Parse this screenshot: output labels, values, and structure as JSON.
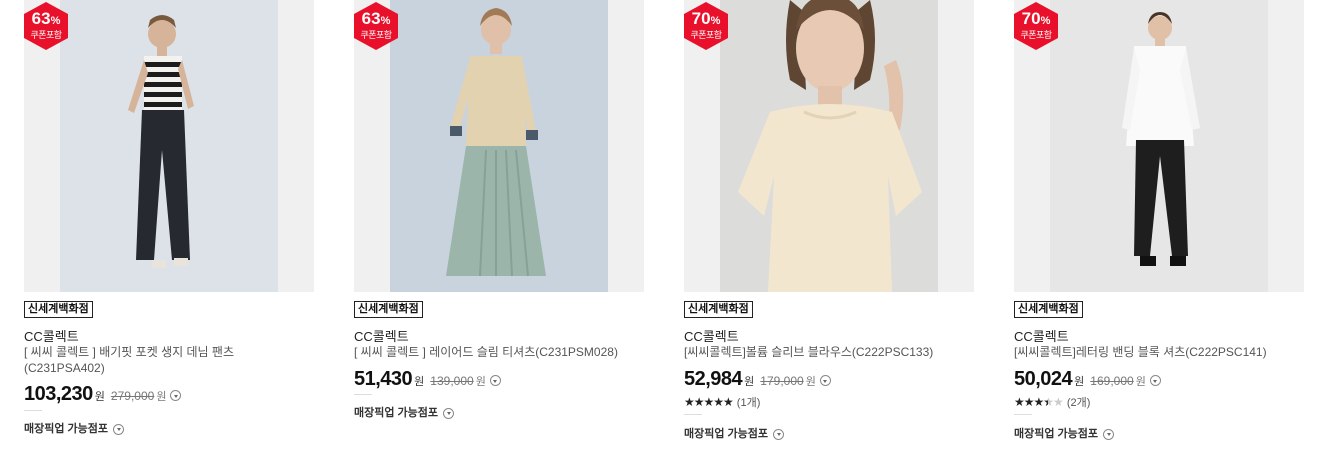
{
  "colors": {
    "badge": "#e8102a",
    "text": "#222222",
    "muted": "#777777"
  },
  "products": [
    {
      "badge": {
        "percent": "63",
        "unit": "%",
        "sub": "쿠폰포함"
      },
      "store": "신세계백화점",
      "brand": "CC콜렉트",
      "name": "[ 씨씨 콜렉트 ] 배기핏 포켓 생지 데님 팬츠(C231PSA402)",
      "price": "103,230",
      "won": "원",
      "original_price": "279,000",
      "original_won": "원",
      "pickup": "매장픽업 가능점포"
    },
    {
      "badge": {
        "percent": "63",
        "unit": "%",
        "sub": "쿠폰포함"
      },
      "store": "신세계백화점",
      "brand": "CC콜렉트",
      "name": "[ 씨씨 콜렉트 ] 레이어드 슬림 티셔츠(C231PSM028)",
      "price": "51,430",
      "won": "원",
      "original_price": "139,000",
      "original_won": "원",
      "pickup": "매장픽업 가능점포"
    },
    {
      "badge": {
        "percent": "70",
        "unit": "%",
        "sub": "쿠폰포함"
      },
      "store": "신세계백화점",
      "brand": "CC콜렉트",
      "name": "[씨씨콜렉트]볼륨 슬리브 블라우스(C222PSC133)",
      "price": "52,984",
      "won": "원",
      "original_price": "179,000",
      "original_won": "원",
      "rating": {
        "stars": 5,
        "count": "(1개)"
      },
      "pickup": "매장픽업 가능점포"
    },
    {
      "badge": {
        "percent": "70",
        "unit": "%",
        "sub": "쿠폰포함"
      },
      "store": "신세계백화점",
      "brand": "CC콜렉트",
      "name": "[씨씨콜렉트]레터링 밴딩 블록 셔츠(C222PSC141)",
      "price": "50,024",
      "won": "원",
      "original_price": "169,000",
      "original_won": "원",
      "rating": {
        "stars": 3.5,
        "count": "(2개)"
      },
      "pickup": "매장픽업 가능점포"
    }
  ]
}
